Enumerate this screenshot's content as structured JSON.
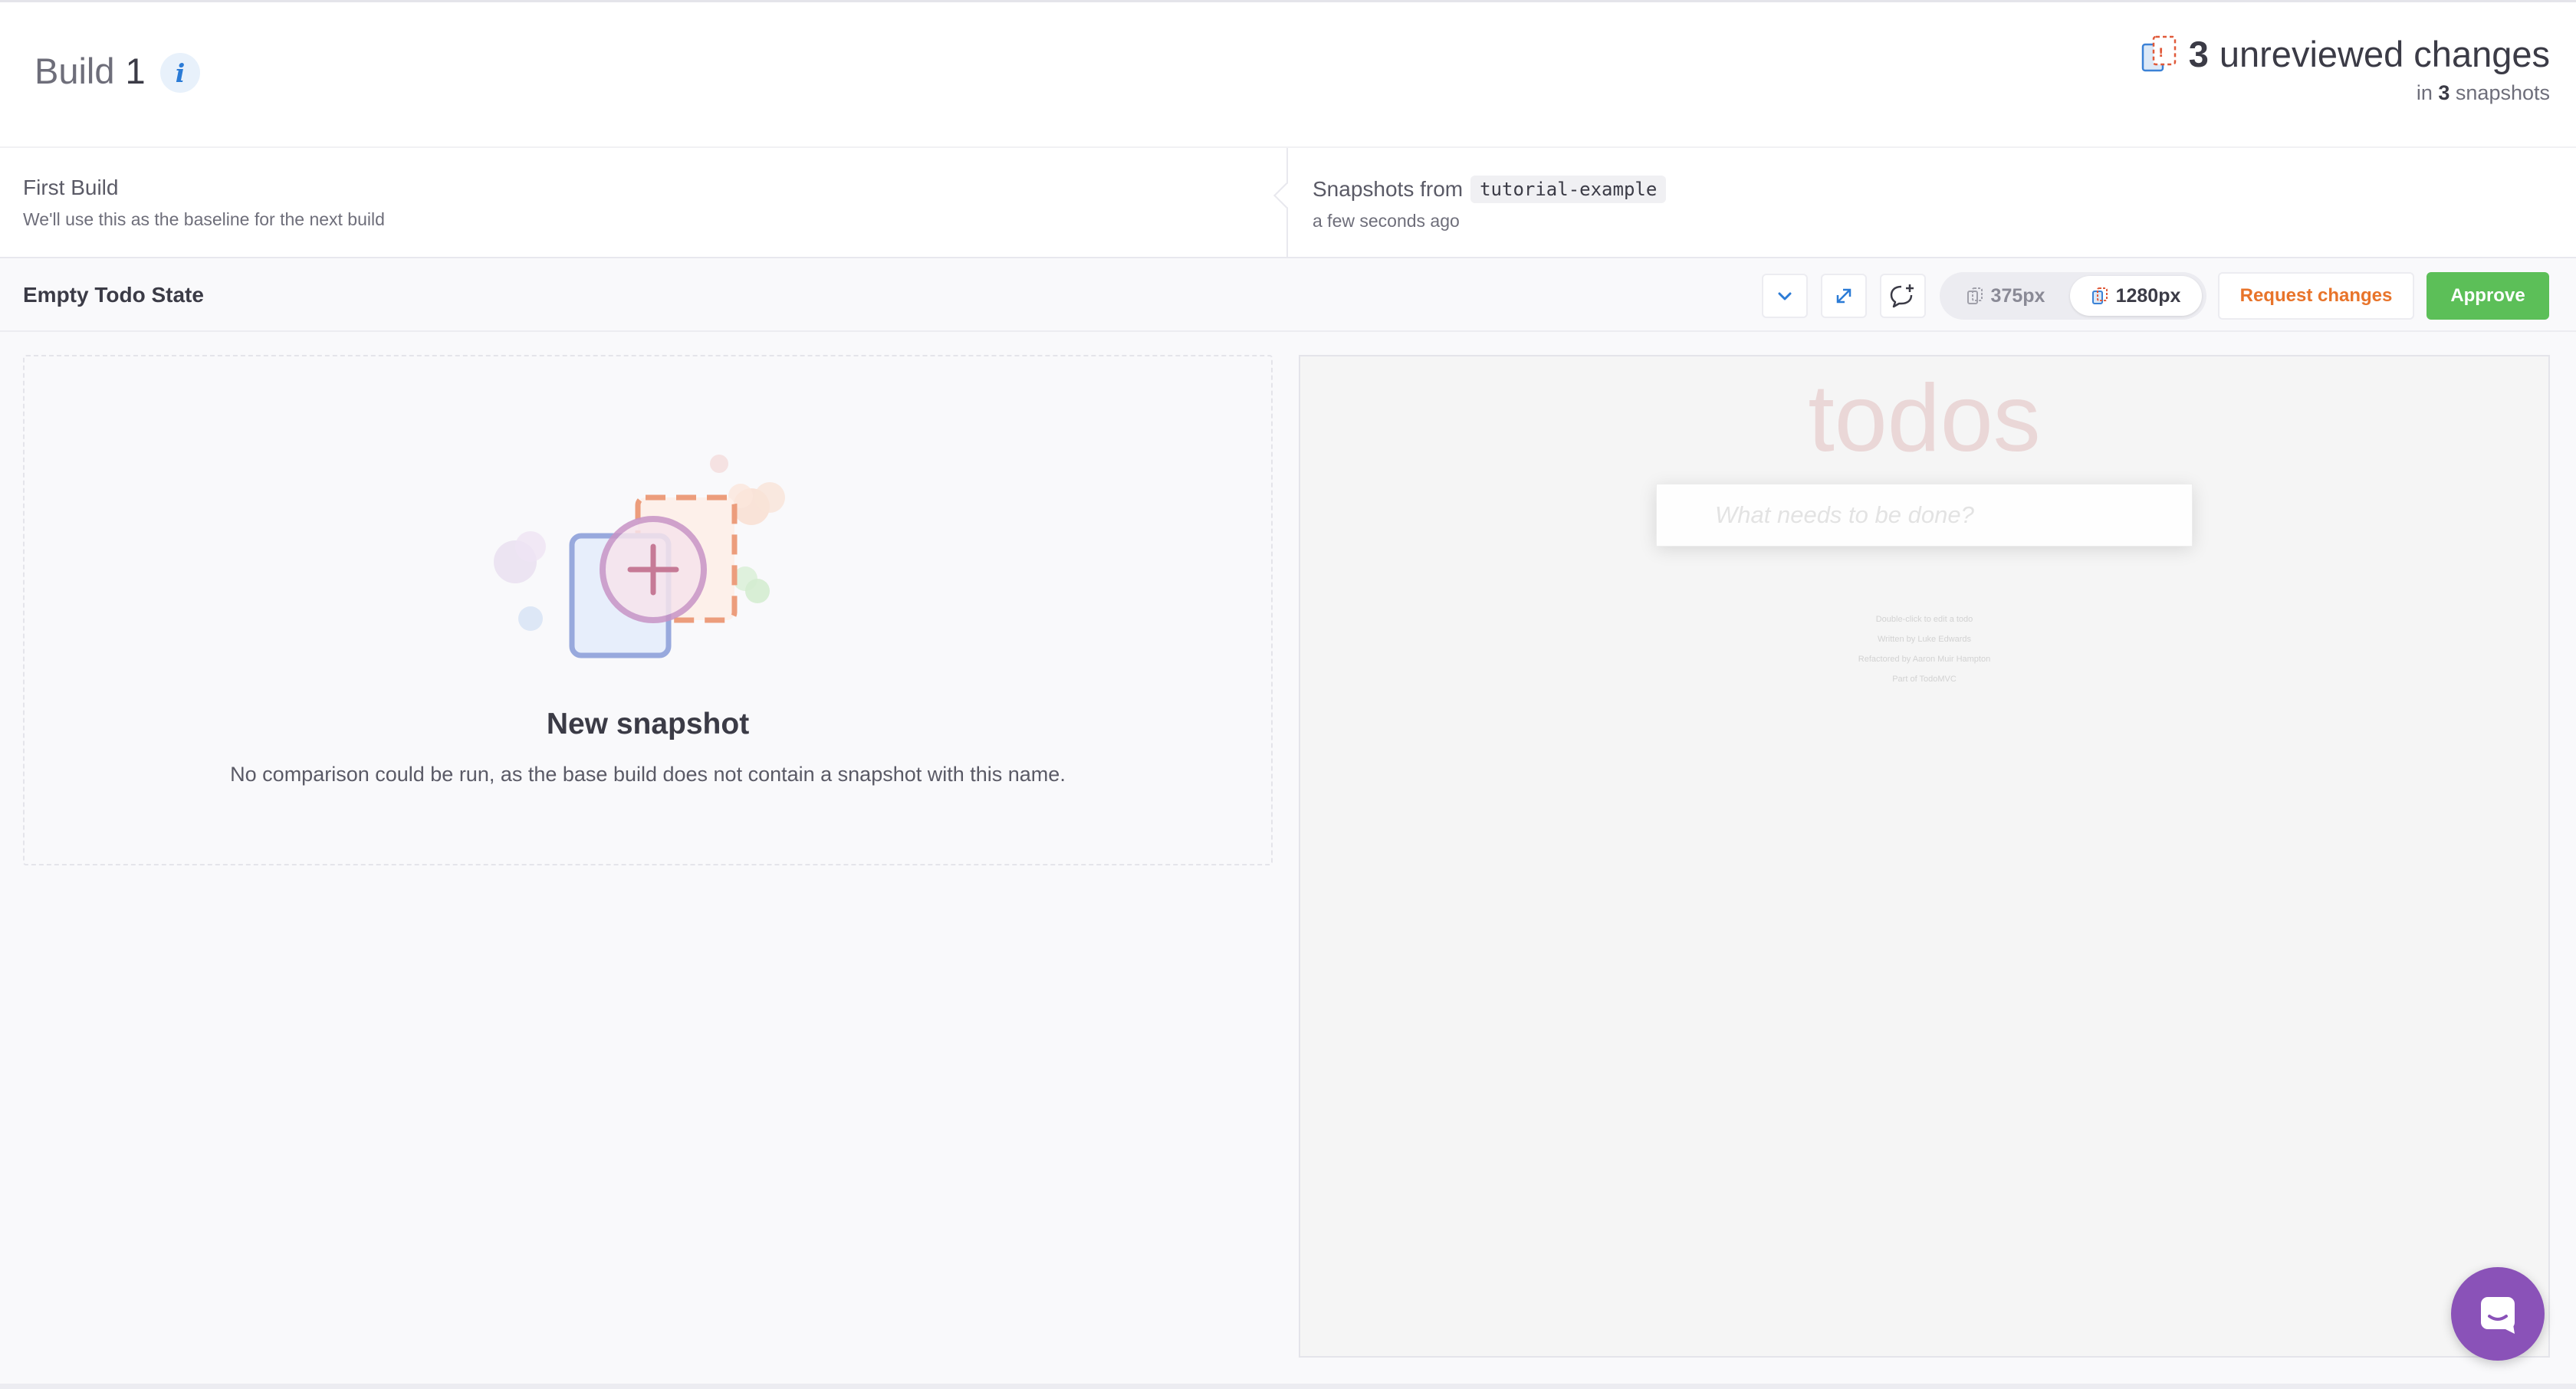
{
  "build": {
    "label": "Build",
    "number": "1",
    "info_glyph": "i"
  },
  "changes": {
    "count": "3",
    "label": "unreviewed changes",
    "in_label": "in",
    "snapshot_count": "3",
    "snapshots_label": "snapshots"
  },
  "baseline": {
    "left_title": "First Build",
    "left_subtitle": "We'll use this as the baseline for the next build",
    "right_prefix": "Snapshots from",
    "branch": "tutorial-example",
    "right_subtitle": "a few seconds ago"
  },
  "snapshot": {
    "name": "Empty Todo State",
    "widths": [
      {
        "label": "375px",
        "selected": false
      },
      {
        "label": "1280px",
        "selected": true
      }
    ],
    "request_changes_label": "Request changes",
    "approve_label": "Approve"
  },
  "left_panel": {
    "title": "New snapshot",
    "description": "No comparison could be run, as the base build does not contain a snapshot with this name."
  },
  "preview": {
    "app_title": "todos",
    "input_placeholder": "What needs to be done?",
    "footer": [
      "Double-click to edit a todo",
      "Written by Luke Edwards",
      "Refactored by Aaron Muir Hampton",
      "Part of TodoMVC"
    ]
  },
  "colors": {
    "approve": "#5cbf58",
    "request_changes": "#e8742a",
    "chat": "#8a52b8",
    "info": "#2b7bd6"
  },
  "icons": {
    "info": "info-icon",
    "changes": "stacked-snapshots-icon",
    "collapse": "chevron-down-icon",
    "fullscreen": "expand-icon",
    "comment": "add-comment-icon",
    "chat": "chat-icon"
  }
}
